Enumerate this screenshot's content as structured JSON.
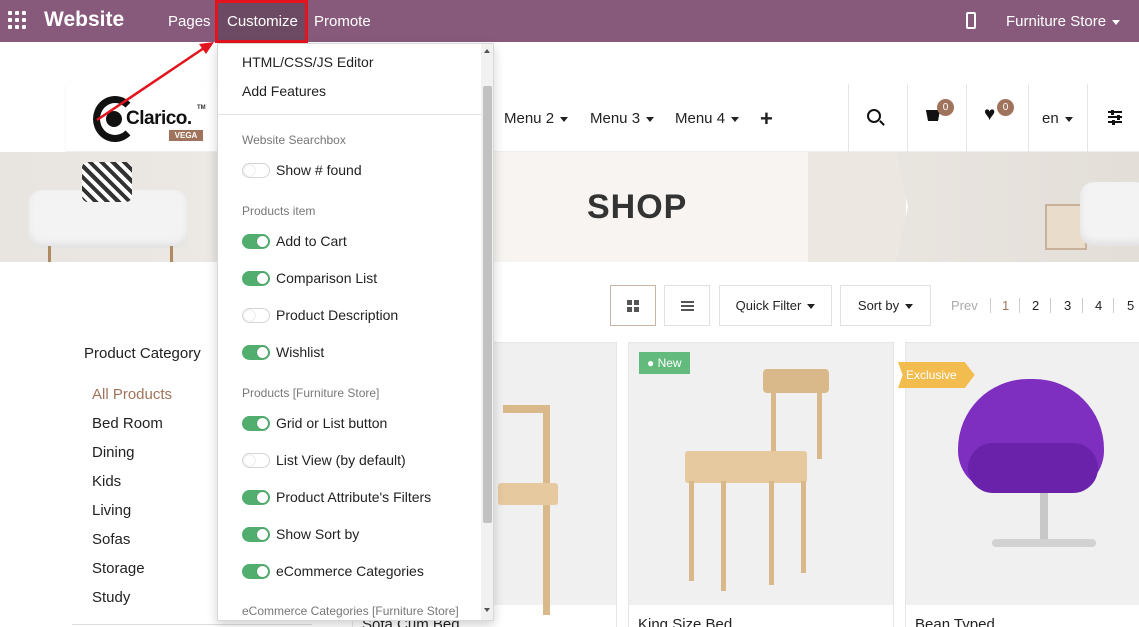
{
  "topbar": {
    "brand": "Website",
    "nav": [
      "Pages",
      "Customize",
      "Promote"
    ],
    "store": "Furniture Store"
  },
  "site_header": {
    "logo_text": "Clarico.",
    "logo_tm": "TM",
    "logo_sub": "VEGA",
    "menus": [
      "Menu 2",
      "Menu 3",
      "Menu 4"
    ],
    "cart_count": "0",
    "wishlist_count": "0",
    "language": "en"
  },
  "banner": {
    "title": "SHOP"
  },
  "toolbar": {
    "quick_filter": "Quick Filter",
    "sort_by": "Sort by",
    "pager_prev": "Prev",
    "pages": [
      "1",
      "2",
      "3",
      "4",
      "5"
    ]
  },
  "categories": {
    "title": "Product Category",
    "items": [
      "All Products",
      "Bed Room",
      "Dining",
      "Kids",
      "Living",
      "Sofas",
      "Storage",
      "Study"
    ]
  },
  "products": [
    {
      "name": "Sofa Cum Bed",
      "tag": ""
    },
    {
      "name": "King Size Bed",
      "tag": "New"
    },
    {
      "name": "Bean Typed",
      "tag": "Exclusive"
    }
  ],
  "customize_menu": {
    "links": [
      "HTML/CSS/JS Editor",
      "Add Features"
    ],
    "sections": [
      {
        "heading": "Website Searchbox",
        "options": [
          {
            "label": "Show # found",
            "on": false
          }
        ]
      },
      {
        "heading": "Products item",
        "options": [
          {
            "label": "Add to Cart",
            "on": true
          },
          {
            "label": "Comparison List",
            "on": true
          },
          {
            "label": "Product Description",
            "on": false
          },
          {
            "label": "Wishlist",
            "on": true
          }
        ]
      },
      {
        "heading": "Products [Furniture Store]",
        "options": [
          {
            "label": "Grid or List button",
            "on": true
          },
          {
            "label": "List View (by default)",
            "on": false
          },
          {
            "label": "Product Attribute's Filters",
            "on": true
          },
          {
            "label": "Show Sort by",
            "on": true
          },
          {
            "label": "eCommerce Categories",
            "on": true
          }
        ]
      },
      {
        "heading": "eCommerce Categories [Furniture Store]",
        "options": []
      }
    ]
  },
  "colors": {
    "admin_bar": "#875a7b",
    "highlight": "#e3141e",
    "toggle_on": "#52ae6e",
    "accent": "#a0745c",
    "tag_new": "#62bb7c",
    "tag_exclusive": "#f3bc4f"
  },
  "icons": [
    "apps-grid-icon",
    "mobile-icon",
    "search-icon",
    "cart-icon",
    "heart-icon",
    "sliders-icon",
    "grid-view-icon",
    "list-view-icon",
    "tag-icon"
  ]
}
